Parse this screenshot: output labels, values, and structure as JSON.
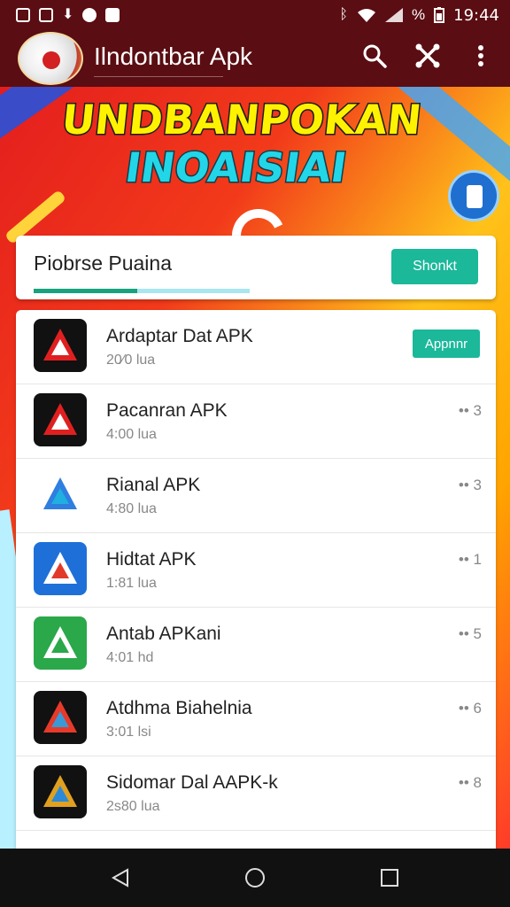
{
  "status_bar": {
    "time": "19:44",
    "battery_percent": "%",
    "left_icons": [
      "photo-icon",
      "image-icon",
      "download-icon",
      "sync-icon",
      "notification-icon"
    ],
    "right_icons": [
      "bluetooth-icon",
      "wifi-icon",
      "signal-icon",
      "battery-icon"
    ]
  },
  "app_bar": {
    "title": "Ilndontbar Apk",
    "actions": [
      "search-icon",
      "share-icon",
      "more-vert-icon"
    ]
  },
  "banner": {
    "line1": "UNDBANPOKAN",
    "line2": "INOAISIAI"
  },
  "card": {
    "title": "Piobrse Puaina",
    "button_label": "Shonkt",
    "progress": 0.48
  },
  "apps": [
    {
      "name": "Ardaptar Dat APK",
      "meta": "20⁄0 lua",
      "action": "Appnnr",
      "icon_colors": [
        "#111111",
        "#e02020",
        "#ffffff"
      ]
    },
    {
      "name": "Pacanran APK",
      "meta": "4:00 lua",
      "count": "•• 3",
      "icon_colors": [
        "#111111",
        "#e02020",
        "#ffffff"
      ]
    },
    {
      "name": "Rianal APK",
      "meta": "4:80 lua",
      "count": "•• 3",
      "icon_colors": [
        "#ffffff",
        "#2f7ee0",
        "#1fb0e0"
      ]
    },
    {
      "name": "Hidtat APK",
      "meta": "1:81 lua",
      "count": "•• 1",
      "icon_colors": [
        "#1e70d8",
        "#ffffff",
        "#e23a2a"
      ]
    },
    {
      "name": "Antab APKani",
      "meta": "4:01 hd",
      "count": "•• 5",
      "icon_colors": [
        "#2aa84a",
        "#ffffff",
        "#2aa84a"
      ]
    },
    {
      "name": "Atdhma Biahelnia",
      "meta": "3:01 lsi",
      "count": "•• 6",
      "icon_colors": [
        "#111111",
        "#e63a2a",
        "#3a9ad8"
      ]
    },
    {
      "name": "Sidomar Dal AAPK-k",
      "meta": "2s80 lua",
      "count": "•• 8",
      "icon_colors": [
        "#111111",
        "#e0a020",
        "#2a8ad8"
      ]
    }
  ],
  "nav_bar": {
    "buttons": [
      "back-icon",
      "home-icon",
      "recents-icon"
    ]
  }
}
